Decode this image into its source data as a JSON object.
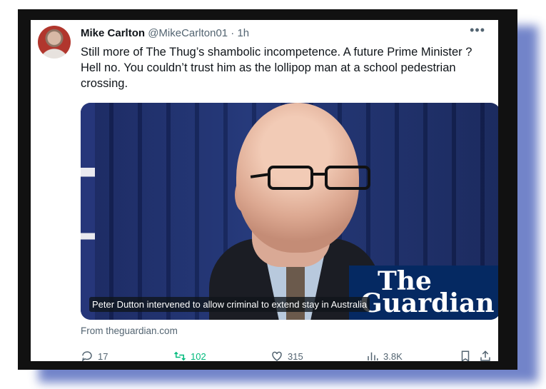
{
  "tweet": {
    "author_name": "Mike Carlton",
    "handle": "@MikeCarlton01",
    "separator": "·",
    "time": "1h",
    "more_label": "•••",
    "text": "Still more of The Thug’s shambolic incompetence. A future Prime Minister ? Hell no. You couldn’t trust him as the lollipop man at a school pedestrian crossing."
  },
  "media": {
    "caption": "Peter Dutton intervened to allow criminal to extend stay in Australia",
    "logo_line1": "The",
    "logo_line2": "Guardian",
    "source": "From theguardian.com"
  },
  "actions": {
    "replies": "17",
    "retweets": "102",
    "likes": "315",
    "views": "3.8K"
  },
  "colors": {
    "frame": "#111111",
    "shadow": "#5a6fc0",
    "retweet_green": "#00ba7c",
    "guardian_blue": "#052962"
  },
  "icons": [
    "reply-icon",
    "retweet-icon",
    "like-icon",
    "views-icon",
    "bookmark-icon",
    "share-icon",
    "more-icon"
  ]
}
